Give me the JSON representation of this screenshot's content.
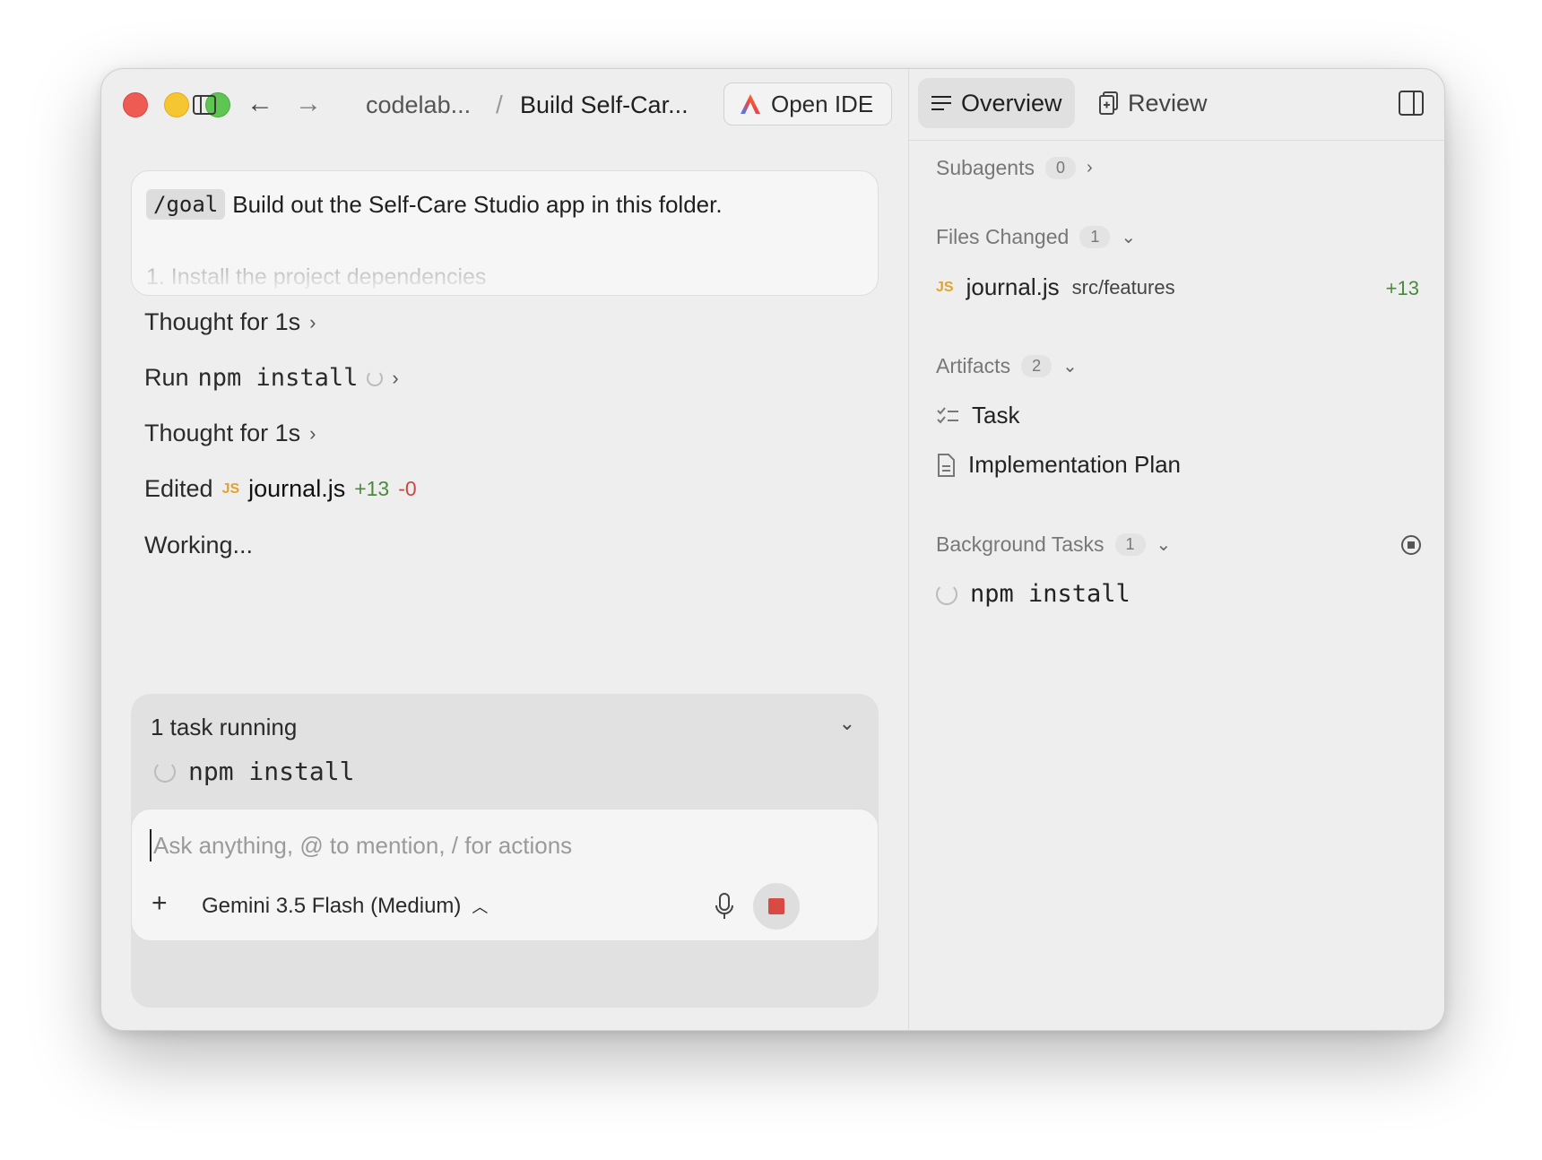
{
  "titlebar": {
    "breadcrumb_project": "codelab...",
    "breadcrumb_sep": "/",
    "breadcrumb_task": "Build Self-Car...",
    "open_ide_label": "Open IDE"
  },
  "prompt": {
    "command": "/goal",
    "text": "Build out the Self-Care Studio app in this folder.",
    "faded_line": "1. Install the project dependencies"
  },
  "steps": {
    "thought1": "Thought for 1s",
    "run_prefix": "Run",
    "run_command": "npm install",
    "thought2": "Thought for 1s",
    "edited_prefix": "Edited",
    "edited_badge": "JS",
    "edited_file": "journal.js",
    "edited_add": "+13",
    "edited_del": "-0",
    "working": "Working..."
  },
  "task_panel": {
    "title": "1 task running",
    "item": "npm install"
  },
  "composer": {
    "placeholder": "Ask anything, @ to mention, / for actions",
    "plus": "+",
    "model": "Gemini 3.5 Flash (Medium)"
  },
  "right": {
    "tabs": {
      "overview": "Overview",
      "review": "Review"
    },
    "subagents": {
      "label": "Subagents",
      "count": "0"
    },
    "files_changed": {
      "label": "Files Changed",
      "count": "1",
      "file": {
        "badge": "JS",
        "name": "journal.js",
        "path": "src/features",
        "delta": "+13"
      }
    },
    "artifacts": {
      "label": "Artifacts",
      "count": "2",
      "items": [
        "Task",
        "Implementation Plan"
      ]
    },
    "background_tasks": {
      "label": "Background Tasks",
      "count": "1",
      "item": "npm install"
    }
  },
  "colors": {
    "window_bg": "#eeeeee",
    "add_green": "#4b8a3e",
    "del_red": "#c94a42",
    "js_orange": "#e0a230",
    "stop_red": "#d84b44"
  }
}
